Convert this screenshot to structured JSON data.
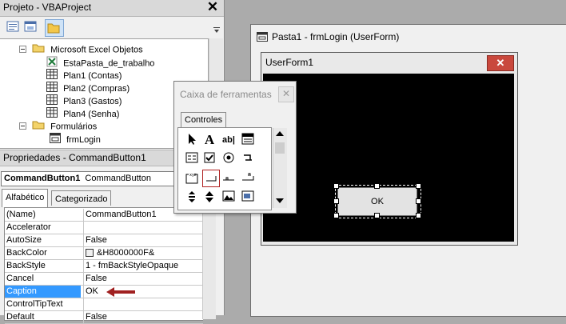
{
  "project": {
    "title": "Projeto - VBAProject",
    "close_label": "✕",
    "tree": [
      {
        "label": "Microsoft Excel Objetos",
        "icon": "folder-icon"
      },
      {
        "label": "EstaPasta_de_trabalho",
        "icon": "excel-workbook-icon"
      },
      {
        "label": "Plan1 (Contas)",
        "icon": "sheet-icon"
      },
      {
        "label": "Plan2 (Compras)",
        "icon": "sheet-icon"
      },
      {
        "label": "Plan3 (Gastos)",
        "icon": "sheet-icon"
      },
      {
        "label": "Plan4 (Senha)",
        "icon": "sheet-icon"
      },
      {
        "label": "Formulários",
        "icon": "folder-icon"
      },
      {
        "label": "frmLogin",
        "icon": "form-icon"
      }
    ]
  },
  "properties": {
    "title": "Propriedades - CommandButton1",
    "object_name": "CommandButton1",
    "object_type": "CommandButton",
    "tabs": [
      "Alfabético",
      "Categorizado"
    ],
    "rows": [
      {
        "name": "(Name)",
        "value": "CommandButton1"
      },
      {
        "name": "Accelerator",
        "value": ""
      },
      {
        "name": "AutoSize",
        "value": "False"
      },
      {
        "name": "BackColor",
        "value": "&H8000000F&"
      },
      {
        "name": "BackStyle",
        "value": "1 - fmBackStyleOpaque"
      },
      {
        "name": "Cancel",
        "value": "False"
      },
      {
        "name": "Caption",
        "value": "OK"
      },
      {
        "name": "ControlTipText",
        "value": ""
      },
      {
        "name": "Default",
        "value": "False"
      }
    ],
    "highlight_color": "#3399ff",
    "arrow_color": "#a02020"
  },
  "designer": {
    "window_title": "Pasta1 - frmLogin (UserForm)",
    "form_title": "UserForm1",
    "form_close": "✕",
    "button_caption": "OK"
  },
  "toolbox": {
    "title": "Caixa de ferramentas",
    "close": "✕",
    "tab": "Controles"
  }
}
